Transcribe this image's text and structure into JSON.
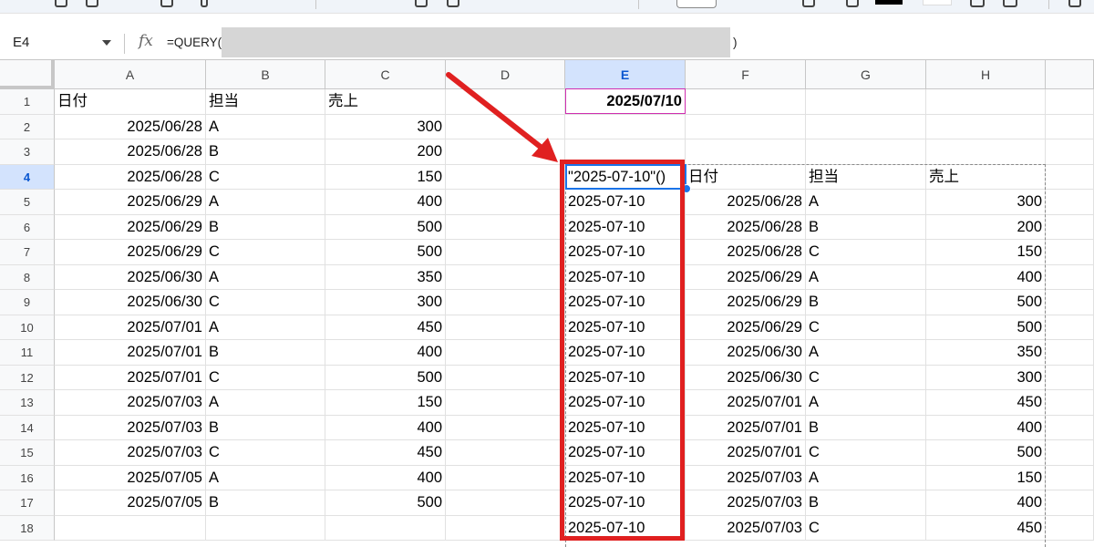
{
  "formula_bar": {
    "name_box": "E4",
    "fx_label": "fx",
    "formula_start": "=QUERY(",
    "formula_end": ")"
  },
  "columns": [
    "A",
    "B",
    "C",
    "D",
    "E",
    "F",
    "G",
    "H"
  ],
  "rows": [
    {
      "num": "1",
      "a": "日付",
      "b": "担当",
      "c": "売上",
      "d": "",
      "e": "2025/07/10",
      "f": "",
      "g": "",
      "h": ""
    },
    {
      "num": "2",
      "a": "2025/06/28",
      "b": "A",
      "c": "300",
      "d": "",
      "e": "",
      "f": "",
      "g": "",
      "h": ""
    },
    {
      "num": "3",
      "a": "2025/06/28",
      "b": "B",
      "c": "200",
      "d": "",
      "e": "",
      "f": "",
      "g": "",
      "h": ""
    },
    {
      "num": "4",
      "a": "2025/06/28",
      "b": "C",
      "c": "150",
      "d": "",
      "e": "\"2025-07-10\"()",
      "f": "日付",
      "g": "担当",
      "h": "売上"
    },
    {
      "num": "5",
      "a": "2025/06/29",
      "b": "A",
      "c": "400",
      "d": "",
      "e": "2025-07-10",
      "f": "2025/06/28",
      "g": "A",
      "h": "300"
    },
    {
      "num": "6",
      "a": "2025/06/29",
      "b": "B",
      "c": "500",
      "d": "",
      "e": "2025-07-10",
      "f": "2025/06/28",
      "g": "B",
      "h": "200"
    },
    {
      "num": "7",
      "a": "2025/06/29",
      "b": "C",
      "c": "500",
      "d": "",
      "e": "2025-07-10",
      "f": "2025/06/28",
      "g": "C",
      "h": "150"
    },
    {
      "num": "8",
      "a": "2025/06/30",
      "b": "A",
      "c": "350",
      "d": "",
      "e": "2025-07-10",
      "f": "2025/06/29",
      "g": "A",
      "h": "400"
    },
    {
      "num": "9",
      "a": "2025/06/30",
      "b": "C",
      "c": "300",
      "d": "",
      "e": "2025-07-10",
      "f": "2025/06/29",
      "g": "B",
      "h": "500"
    },
    {
      "num": "10",
      "a": "2025/07/01",
      "b": "A",
      "c": "450",
      "d": "",
      "e": "2025-07-10",
      "f": "2025/06/29",
      "g": "C",
      "h": "500"
    },
    {
      "num": "11",
      "a": "2025/07/01",
      "b": "B",
      "c": "400",
      "d": "",
      "e": "2025-07-10",
      "f": "2025/06/30",
      "g": "A",
      "h": "350"
    },
    {
      "num": "12",
      "a": "2025/07/01",
      "b": "C",
      "c": "500",
      "d": "",
      "e": "2025-07-10",
      "f": "2025/06/30",
      "g": "C",
      "h": "300"
    },
    {
      "num": "13",
      "a": "2025/07/03",
      "b": "A",
      "c": "150",
      "d": "",
      "e": "2025-07-10",
      "f": "2025/07/01",
      "g": "A",
      "h": "450"
    },
    {
      "num": "14",
      "a": "2025/07/03",
      "b": "B",
      "c": "400",
      "d": "",
      "e": "2025-07-10",
      "f": "2025/07/01",
      "g": "B",
      "h": "400"
    },
    {
      "num": "15",
      "a": "2025/07/03",
      "b": "C",
      "c": "450",
      "d": "",
      "e": "2025-07-10",
      "f": "2025/07/01",
      "g": "C",
      "h": "500"
    },
    {
      "num": "16",
      "a": "2025/07/05",
      "b": "A",
      "c": "400",
      "d": "",
      "e": "2025-07-10",
      "f": "2025/07/03",
      "g": "A",
      "h": "150"
    },
    {
      "num": "17",
      "a": "2025/07/05",
      "b": "B",
      "c": "500",
      "d": "",
      "e": "2025-07-10",
      "f": "2025/07/03",
      "g": "B",
      "h": "400"
    },
    {
      "num": "18",
      "a": "",
      "b": "",
      "c": "",
      "d": "",
      "e": "2025-07-10",
      "f": "2025/07/03",
      "g": "C",
      "h": "450"
    }
  ],
  "selection": {
    "cell": "E4",
    "column": "E",
    "row": "4"
  },
  "colors": {
    "accent": "#1a73e8",
    "annotation": "#e02020",
    "referenced_cell_border": "#d02eb0"
  }
}
